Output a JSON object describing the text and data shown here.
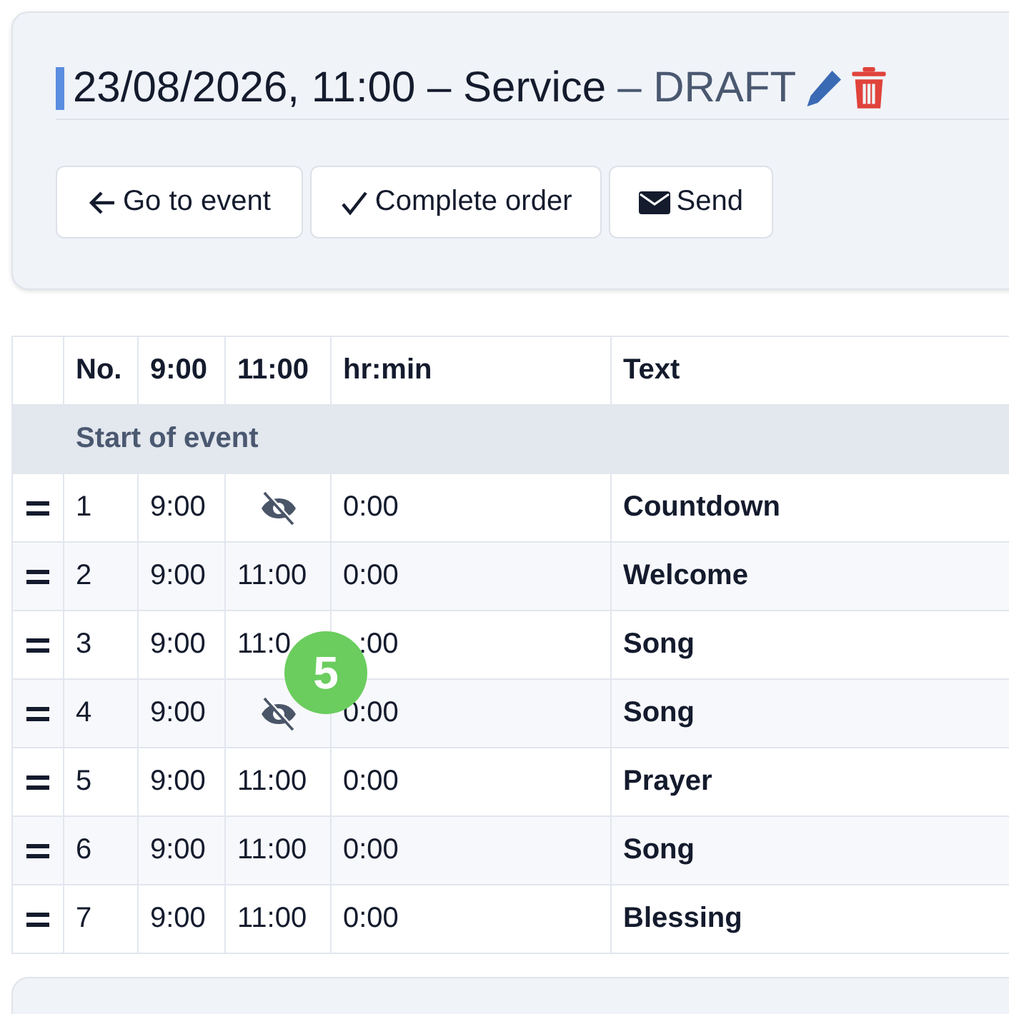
{
  "header": {
    "title": "23/08/2026, 11:00 – Service",
    "status": "– DRAFT"
  },
  "buttons": [
    {
      "label": "Go to event"
    },
    {
      "label": "Complete order"
    },
    {
      "label": "Send"
    }
  ],
  "table": {
    "columns": [
      "No.",
      "9:00",
      "11:00",
      "hr:min",
      "Text"
    ],
    "group": "Start of event",
    "rows": [
      {
        "no": "1",
        "t1": "9:00",
        "t2": "",
        "hidden": true,
        "duration": "0:00",
        "text": "Countdown"
      },
      {
        "no": "2",
        "t1": "9:00",
        "t2": "11:00",
        "hidden": false,
        "duration": "0:00",
        "text": "Welcome"
      },
      {
        "no": "3",
        "t1": "9:00",
        "t2": "11:0",
        "hidden": false,
        "duration": ":00",
        "text": "Song"
      },
      {
        "no": "4",
        "t1": "9:00",
        "t2": "",
        "hidden": true,
        "duration": "0:00",
        "text": "Song"
      },
      {
        "no": "5",
        "t1": "9:00",
        "t2": "11:00",
        "hidden": false,
        "duration": "0:00",
        "text": "Prayer"
      },
      {
        "no": "6",
        "t1": "9:00",
        "t2": "11:00",
        "hidden": false,
        "duration": "0:00",
        "text": "Song"
      },
      {
        "no": "7",
        "t1": "9:00",
        "t2": "11:00",
        "hidden": false,
        "duration": "0:00",
        "text": "Blessing"
      }
    ]
  },
  "badge": "5"
}
